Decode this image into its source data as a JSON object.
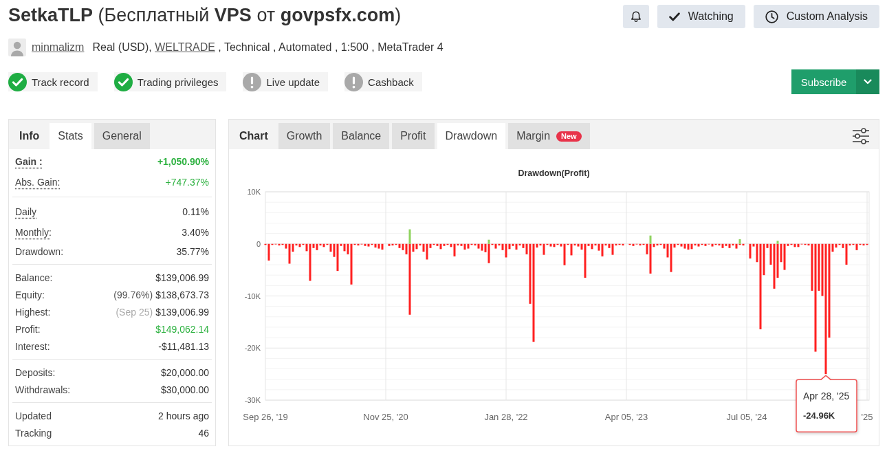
{
  "header": {
    "title": "**SetkaTLP** (Бесплатный **VPS** от **govpsfx.com**)",
    "actions": [
      {
        "kind": "bell"
      },
      {
        "kind": "watch",
        "label": "Watching"
      },
      {
        "kind": "analysis",
        "label": "Custom Analysis"
      }
    ]
  },
  "account": {
    "user": "minmalizm",
    "type": "Real (USD),",
    "broker": "WELTRADE",
    "details": ", Technical , Automated , 1:500 , MetaTrader 4"
  },
  "badges": [
    {
      "label": "Track record",
      "verified": true
    },
    {
      "label": "Trading privileges",
      "verified": true
    },
    {
      "label": "Live update",
      "verified": false
    },
    {
      "label": "Cashback",
      "verified": false
    }
  ],
  "subscribe": {
    "label": "Subscribe"
  },
  "stats_panel": {
    "tabs": [
      {
        "label": "Info",
        "kind": "heading",
        "selected": false
      },
      {
        "label": "Stats",
        "kind": "tab",
        "selected": true
      },
      {
        "label": "General",
        "kind": "tab",
        "selected": false
      }
    ],
    "groups": [
      {
        "rows": [
          {
            "label": "Gain :",
            "value": "+1,050.90%",
            "positive": true,
            "underlined": true,
            "bold": true
          },
          {
            "label": "Abs. Gain:",
            "value": "+747.37%",
            "positive": true,
            "underlined": true,
            "bold": false
          }
        ]
      },
      {
        "rows": [
          {
            "label": "Daily",
            "value": "0.11%",
            "positive": false,
            "underlined": true,
            "bold": false
          },
          {
            "label": "Monthly:",
            "value": "3.40%",
            "positive": false,
            "underlined": true,
            "bold": false
          },
          {
            "label": "Drawdown:",
            "value": "35.77%",
            "positive": false,
            "underlined": false,
            "bold": false
          }
        ]
      },
      {
        "rows": [
          {
            "label": "Balance:",
            "value": "$139,006.99",
            "positive": false,
            "underlined": false,
            "bold": false
          },
          {
            "label": "Equity:",
            "note": "(99.76%)",
            "note_muted": false,
            "value": "$138,673.73",
            "positive": false,
            "underlined": false,
            "bold": false
          },
          {
            "label": "Highest:",
            "note": "(Sep 25)",
            "note_muted": true,
            "value": "$139,006.99",
            "positive": false,
            "underlined": false,
            "bold": false
          },
          {
            "label": "Profit:",
            "value": "$149,062.14",
            "positive": true,
            "underlined": false,
            "bold": false
          },
          {
            "label": "Interest:",
            "value": "-$11,481.13",
            "positive": false,
            "underlined": false,
            "bold": false
          }
        ]
      },
      {
        "rows": [
          {
            "label": "Deposits:",
            "value": "$20,000.00",
            "positive": false,
            "underlined": false,
            "bold": false
          },
          {
            "label": "Withdrawals:",
            "value": "$30,000.00",
            "positive": false,
            "underlined": false,
            "bold": false
          }
        ]
      },
      {
        "rows": [
          {
            "label": "Updated",
            "value": "2 hours ago",
            "positive": false,
            "underlined": false,
            "bold": false
          },
          {
            "label": "Tracking",
            "value": "46",
            "positive": false,
            "underlined": false,
            "bold": false
          }
        ]
      }
    ]
  },
  "chart_panel": {
    "tabs": [
      {
        "label": "Chart",
        "kind": "heading",
        "selected": false
      },
      {
        "label": "Growth",
        "kind": "tab",
        "selected": false
      },
      {
        "label": "Balance",
        "kind": "tab",
        "selected": false
      },
      {
        "label": "Profit",
        "kind": "tab",
        "selected": false
      },
      {
        "label": "Drawdown",
        "kind": "tab",
        "selected": true
      },
      {
        "label": "Margin",
        "kind": "tab",
        "selected": false,
        "badge": "New"
      }
    ],
    "chart_data": {
      "type": "bar",
      "title": "Drawdown(Profit)",
      "grid": true,
      "ylim": [
        -30000,
        10000
      ],
      "yticks": [
        {
          "value": 10000,
          "label": "10K"
        },
        {
          "value": 0,
          "label": "0"
        },
        {
          "value": -10000,
          "label": "-10K"
        },
        {
          "value": -20000,
          "label": "-20K"
        },
        {
          "value": -30000,
          "label": "-30K"
        }
      ],
      "categories": [
        "Sep 26, '19",
        null,
        null,
        null,
        null,
        null,
        null,
        null,
        null,
        null,
        null,
        null,
        null,
        null,
        null,
        null,
        null,
        null,
        null,
        null,
        null,
        null,
        null,
        null,
        null,
        null,
        null,
        null,
        null,
        null,
        null,
        null,
        null,
        null,
        null,
        "Nov 25, '20",
        null,
        null,
        null,
        null,
        null,
        null,
        null,
        null,
        null,
        null,
        null,
        null,
        null,
        null,
        null,
        null,
        null,
        null,
        null,
        null,
        null,
        null,
        null,
        null,
        null,
        null,
        null,
        null,
        null,
        null,
        null,
        null,
        null,
        null,
        "Jan 28, '22",
        null,
        null,
        null,
        null,
        null,
        null,
        null,
        null,
        null,
        null,
        null,
        null,
        null,
        null,
        null,
        null,
        null,
        null,
        null,
        null,
        null,
        null,
        null,
        null,
        null,
        null,
        null,
        null,
        null,
        null,
        null,
        null,
        null,
        null,
        "Apr 05, '23",
        null,
        null,
        null,
        null,
        null,
        null,
        null,
        null,
        null,
        null,
        null,
        null,
        null,
        null,
        null,
        null,
        null,
        null,
        null,
        null,
        null,
        null,
        null,
        null,
        null,
        null,
        null,
        null,
        null,
        null,
        null,
        null,
        null,
        null,
        "Jul 05, '24",
        null,
        null,
        null,
        null,
        null,
        null,
        null,
        null,
        null,
        null,
        null,
        null,
        null,
        null,
        null,
        null,
        null,
        null,
        null,
        null,
        null,
        null,
        null,
        null,
        null,
        null,
        null,
        null,
        null,
        null,
        null,
        null,
        null,
        null,
        "'25"
      ],
      "series": [
        {
          "color": "#ff2020",
          "values": [
            -200,
            -3200,
            -200,
            -100,
            -300,
            -200,
            -900,
            -3800,
            -1500,
            -300,
            -600,
            -200,
            -1400,
            -7100,
            -800,
            -1200,
            -300,
            -600,
            -200,
            -1500,
            -2500,
            -5200,
            -400,
            -1400,
            -2000,
            -7800,
            -200,
            -300,
            -100,
            -400,
            -500,
            -200,
            -700,
            -900,
            -1100,
            null,
            -400,
            -300,
            -200,
            -800,
            -1200,
            -2000,
            -13600,
            -1500,
            -1000,
            -300,
            -1500,
            -3000,
            -800,
            -200,
            -400,
            -1000,
            -400,
            -200,
            -600,
            -2400,
            -300,
            -400,
            -1100,
            -900,
            -200,
            -300,
            -900,
            -1300,
            -1600,
            -3700,
            -200,
            -900,
            -300,
            -1200,
            -2600,
            -1000,
            -400,
            -1100,
            -300,
            -800,
            -2000,
            -11500,
            -18800,
            -700,
            -300,
            -2100,
            -200,
            -500,
            -600,
            -200,
            -500,
            -4100,
            -200,
            -2200,
            -300,
            -500,
            -1100,
            -6500,
            -400,
            -1000,
            -300,
            -1300,
            -2400,
            -300,
            -800,
            -2100,
            -300,
            -200,
            -300,
            null,
            -200,
            -400,
            -100,
            -300,
            -200,
            -2000,
            -5700,
            -600,
            -300,
            -200,
            -900,
            -2600,
            -5400,
            -700,
            -200,
            -500,
            -900,
            -1100,
            -1000,
            -300,
            -500,
            -200,
            -400,
            -100,
            -500,
            -200,
            -300,
            -800,
            -400,
            -800,
            -300,
            -900,
            -200,
            -300,
            null,
            -2800,
            -500,
            -3500,
            -16400,
            -6000,
            -800,
            -4000,
            -8600,
            -6500,
            -3500,
            -5000,
            -400,
            -200,
            -600,
            -600,
            -100,
            -200,
            -300,
            -9000,
            -20700,
            -9000,
            -10000,
            -25000,
            -18000,
            -1500,
            -700,
            -200,
            -800,
            -4000,
            -300,
            -200,
            -1200,
            -200,
            -300,
            -200
          ]
        },
        {
          "color": "#8fd35f",
          "values": [
            null,
            null,
            null,
            null,
            null,
            null,
            null,
            null,
            null,
            null,
            null,
            null,
            null,
            null,
            null,
            null,
            null,
            null,
            null,
            null,
            null,
            null,
            null,
            null,
            null,
            null,
            null,
            null,
            null,
            null,
            null,
            null,
            null,
            null,
            null,
            null,
            null,
            null,
            null,
            null,
            null,
            null,
            2800,
            null,
            null,
            null,
            null,
            null,
            null,
            null,
            null,
            null,
            null,
            null,
            null,
            null,
            null,
            null,
            null,
            null,
            null,
            null,
            null,
            null,
            null,
            800,
            null,
            null,
            null,
            null,
            null,
            null,
            null,
            null,
            null,
            null,
            null,
            null,
            null,
            null,
            null,
            null,
            null,
            null,
            null,
            null,
            null,
            null,
            null,
            null,
            null,
            null,
            null,
            null,
            null,
            null,
            null,
            null,
            null,
            null,
            null,
            null,
            null,
            null,
            null,
            null,
            null,
            null,
            null,
            null,
            null,
            null,
            1600,
            null,
            null,
            null,
            null,
            null,
            null,
            null,
            null,
            null,
            null,
            null,
            null,
            null,
            null,
            null,
            null,
            null,
            null,
            null,
            null,
            null,
            null,
            null,
            null,
            null,
            900,
            null,
            null,
            null,
            null,
            null,
            null,
            null,
            null,
            null,
            null,
            600,
            null,
            null,
            null,
            null,
            null,
            null,
            null,
            null,
            null,
            null,
            null,
            null,
            null,
            null,
            null,
            null,
            null,
            null,
            null,
            null,
            null,
            null,
            null,
            null,
            null,
            null
          ]
        }
      ]
    },
    "tooltip": {
      "date": "Apr 28, '25",
      "value": "-24.96K"
    }
  }
}
